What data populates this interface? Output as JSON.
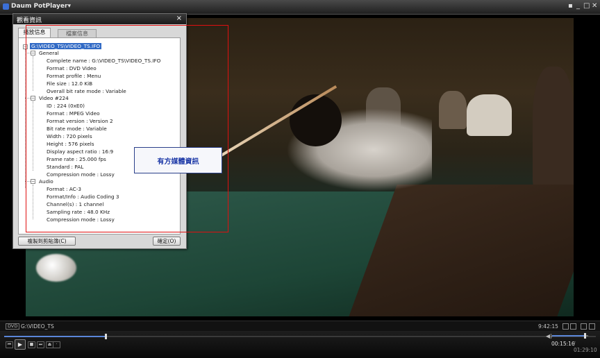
{
  "titlebar": {
    "app_title": "Daum PotPlayer",
    "dropdown_glyph": "▾",
    "close_glyph": "✕",
    "minimize_glyph": "_",
    "restore_glyph": "□",
    "pin_glyph": "▪"
  },
  "dialog": {
    "title": "觀看資訊",
    "close_glyph": "×",
    "tabs": [
      {
        "label": "播放信息"
      },
      {
        "label": "檔案信息"
      }
    ],
    "tree": {
      "root": "G:\\VIDEO_TS\\VIDEO_TS.IFO",
      "sections": [
        {
          "label": "General",
          "items": [
            "Complete name : G:\\VIDEO_TS\\VIDEO_TS.IFO",
            "Format : DVD Video",
            "Format profile : Menu",
            "File size : 12.0 KiB",
            "Overall bit rate mode : Variable"
          ]
        },
        {
          "label": "Video #224",
          "items": [
            "ID : 224 (0xE0)",
            "Format : MPEG Video",
            "Format version : Version 2",
            "Bit rate mode : Variable",
            "Width : 720 pixels",
            "Height : 576 pixels",
            "Display aspect ratio : 16:9",
            "Frame rate : 25.000 fps",
            "Standard : PAL",
            "Compression mode : Lossy"
          ]
        },
        {
          "label": "Audio",
          "items": [
            "Format : AC-3",
            "Format/Info : Audio Coding 3",
            "Channel(s) : 1 channel",
            "Sampling rate : 48.0 KHz",
            "Compression mode : Lossy"
          ]
        }
      ]
    },
    "copy_button": "複製到剪貼簿(C)",
    "ok_button": "確定(O)"
  },
  "annotation": {
    "callout_text": "有方媒體資訊",
    "box_color": "#e01010",
    "callout_color": "#1e3aa8"
  },
  "statusbar": {
    "badge": "DVD",
    "path": "G:\\VIDEO_TS",
    "clock": "9:42:15"
  },
  "controls": {
    "play_glyph": "▶",
    "prev_glyph": "⏮",
    "stop_glyph": "■",
    "next_glyph": "⏭",
    "eject_glyph": "⏏",
    "speaker_glyph": "◀)",
    "time_current": "00:15:16",
    "time_total": "/ 01:29:10",
    "seek_fraction": 0.171,
    "volume_fraction": 0.9
  },
  "colors": {
    "accent": "#5b86d9",
    "selection": "#316ac5"
  }
}
